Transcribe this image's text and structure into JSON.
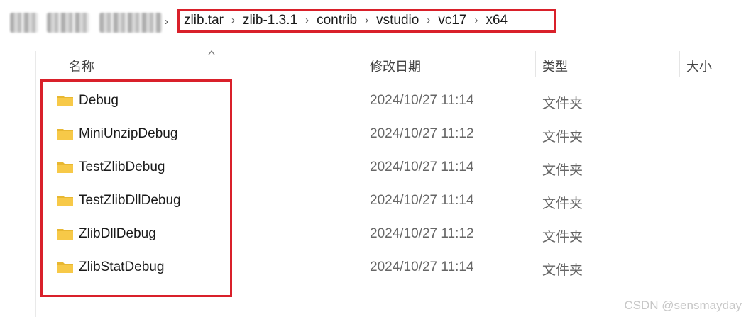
{
  "breadcrumb": {
    "items": [
      "zlib.tar",
      "zlib-1.3.1",
      "contrib",
      "vstudio",
      "vc17",
      "x64"
    ]
  },
  "columns": {
    "name": "名称",
    "modified": "修改日期",
    "type": "类型",
    "size": "大小"
  },
  "files": [
    {
      "name": "Debug",
      "modified": "2024/10/27 11:14",
      "type": "文件夹"
    },
    {
      "name": "MiniUnzipDebug",
      "modified": "2024/10/27 11:12",
      "type": "文件夹"
    },
    {
      "name": "TestZlibDebug",
      "modified": "2024/10/27 11:14",
      "type": "文件夹"
    },
    {
      "name": "TestZlibDllDebug",
      "modified": "2024/10/27 11:14",
      "type": "文件夹"
    },
    {
      "name": "ZlibDllDebug",
      "modified": "2024/10/27 11:12",
      "type": "文件夹"
    },
    {
      "name": "ZlibStatDebug",
      "modified": "2024/10/27 11:14",
      "type": "文件夹"
    }
  ],
  "watermark": "CSDN @sensmayday",
  "colors": {
    "highlight": "#d9202a",
    "folder": "#f7c948"
  }
}
